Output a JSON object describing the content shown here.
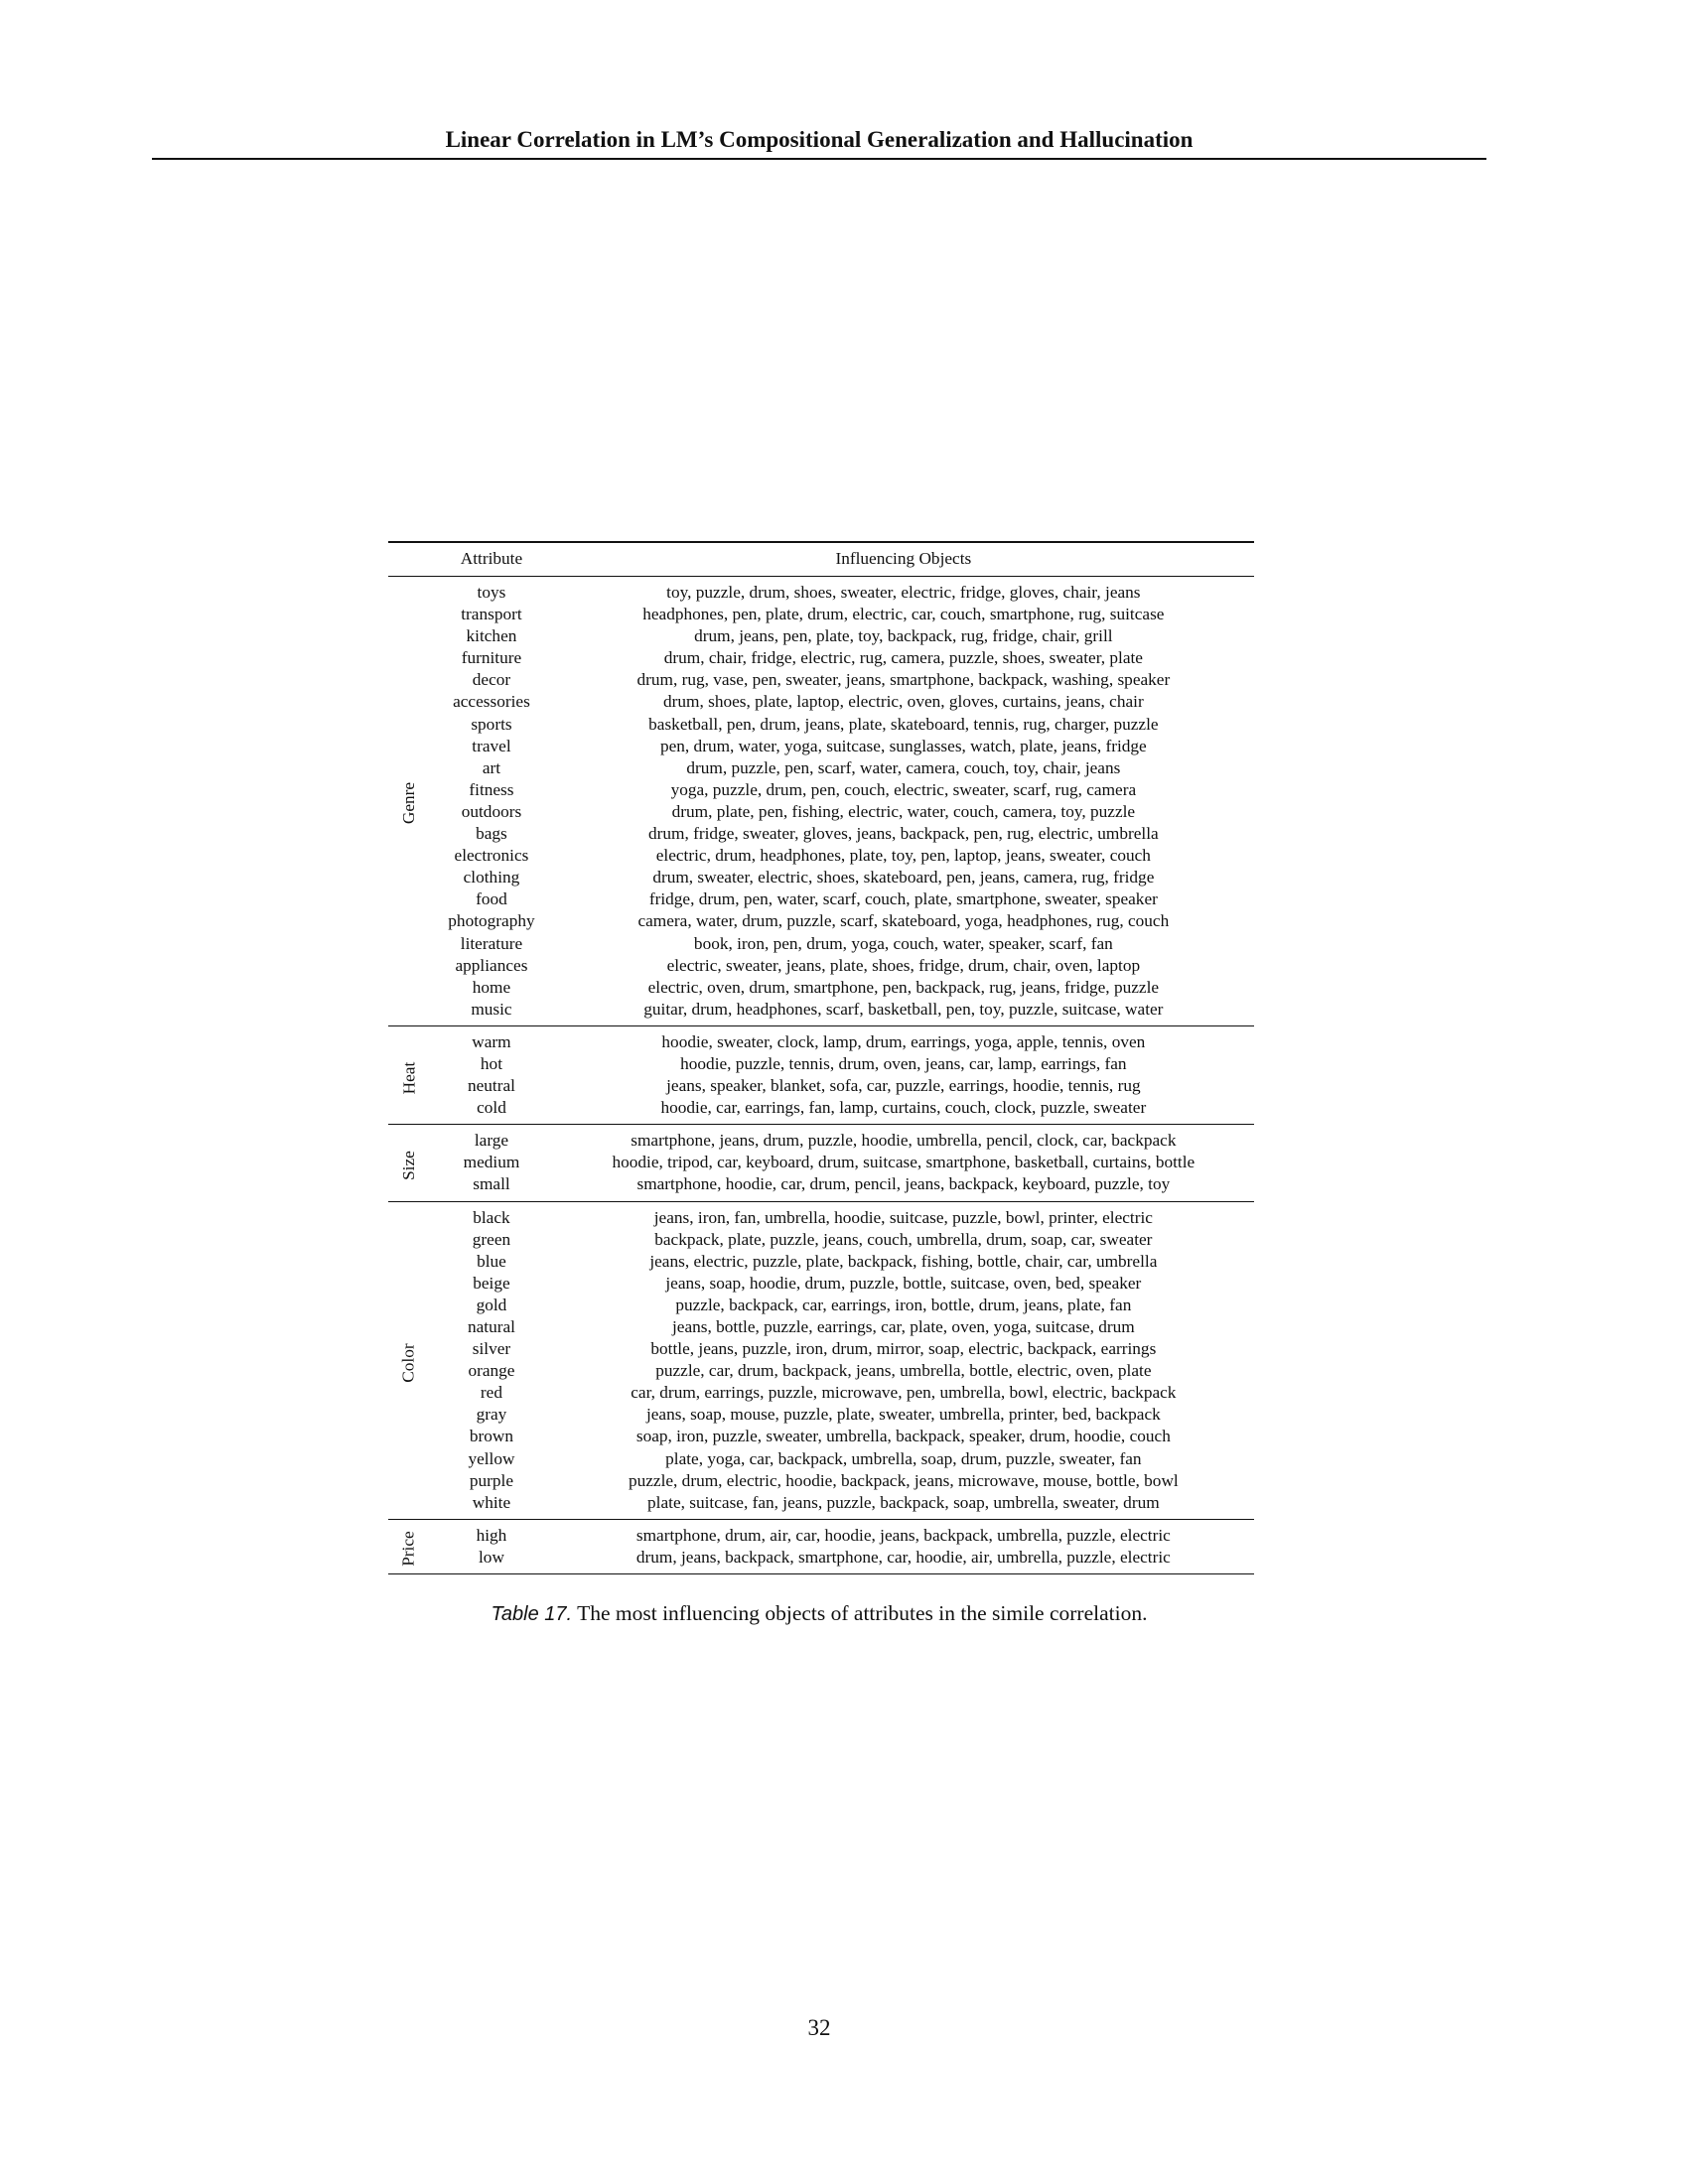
{
  "header": {
    "title": "Linear Correlation in LM’s Compositional Generalization and Hallucination"
  },
  "table": {
    "columns": [
      "",
      "Attribute",
      "Influencing Objects"
    ],
    "groups": [
      {
        "name": "Genre",
        "rows": [
          [
            "toys",
            "toy, puzzle, drum, shoes, sweater, electric, fridge, gloves, chair, jeans"
          ],
          [
            "transport",
            "headphones, pen, plate, drum, electric, car, couch, smartphone, rug, suitcase"
          ],
          [
            "kitchen",
            "drum, jeans, pen, plate, toy, backpack, rug, fridge, chair, grill"
          ],
          [
            "furniture",
            "drum, chair, fridge, electric, rug, camera, puzzle, shoes, sweater, plate"
          ],
          [
            "decor",
            "drum, rug, vase, pen, sweater, jeans, smartphone, backpack, washing, speaker"
          ],
          [
            "accessories",
            "drum, shoes, plate, laptop, electric, oven, gloves, curtains, jeans, chair"
          ],
          [
            "sports",
            "basketball, pen, drum, jeans, plate, skateboard, tennis, rug, charger, puzzle"
          ],
          [
            "travel",
            "pen, drum, water, yoga, suitcase, sunglasses, watch, plate, jeans, fridge"
          ],
          [
            "art",
            "drum, puzzle, pen, scarf, water, camera, couch, toy, chair, jeans"
          ],
          [
            "fitness",
            "yoga, puzzle, drum, pen, couch, electric, sweater, scarf, rug, camera"
          ],
          [
            "outdoors",
            "drum, plate, pen, fishing, electric, water, couch, camera, toy, puzzle"
          ],
          [
            "bags",
            "drum, fridge, sweater, gloves, jeans, backpack, pen, rug, electric, umbrella"
          ],
          [
            "electronics",
            "electric, drum, headphones, plate, toy, pen, laptop, jeans, sweater, couch"
          ],
          [
            "clothing",
            "drum, sweater, electric, shoes, skateboard, pen, jeans, camera, rug, fridge"
          ],
          [
            "food",
            "fridge, drum, pen, water, scarf, couch, plate, smartphone, sweater, speaker"
          ],
          [
            "photography",
            "camera, water, drum, puzzle, scarf, skateboard, yoga, headphones, rug, couch"
          ],
          [
            "literature",
            "book, iron, pen, drum, yoga, couch, water, speaker, scarf, fan"
          ],
          [
            "appliances",
            "electric, sweater, jeans, plate, shoes, fridge, drum, chair, oven, laptop"
          ],
          [
            "home",
            "electric, oven, drum, smartphone, pen, backpack, rug, jeans, fridge, puzzle"
          ],
          [
            "music",
            "guitar, drum, headphones, scarf, basketball, pen, toy, puzzle, suitcase, water"
          ]
        ]
      },
      {
        "name": "Heat",
        "rows": [
          [
            "warm",
            "hoodie, sweater, clock, lamp, drum, earrings, yoga, apple, tennis, oven"
          ],
          [
            "hot",
            "hoodie, puzzle, tennis, drum, oven, jeans, car, lamp, earrings, fan"
          ],
          [
            "neutral",
            "jeans, speaker, blanket, sofa, car, puzzle, earrings, hoodie, tennis, rug"
          ],
          [
            "cold",
            "hoodie, car, earrings, fan, lamp, curtains, couch, clock, puzzle, sweater"
          ]
        ]
      },
      {
        "name": "Size",
        "rows": [
          [
            "large",
            "smartphone, jeans, drum, puzzle, hoodie, umbrella, pencil, clock, car, backpack"
          ],
          [
            "medium",
            "hoodie, tripod, car, keyboard, drum, suitcase, smartphone, basketball, curtains, bottle"
          ],
          [
            "small",
            "smartphone, hoodie, car, drum, pencil, jeans, backpack, keyboard, puzzle, toy"
          ]
        ]
      },
      {
        "name": "Color",
        "rows": [
          [
            "black",
            "jeans, iron, fan, umbrella, hoodie, suitcase, puzzle, bowl, printer, electric"
          ],
          [
            "green",
            "backpack, plate, puzzle, jeans, couch, umbrella, drum, soap, car, sweater"
          ],
          [
            "blue",
            "jeans, electric, puzzle, plate, backpack, fishing, bottle, chair, car, umbrella"
          ],
          [
            "beige",
            "jeans, soap, hoodie, drum, puzzle, bottle, suitcase, oven, bed, speaker"
          ],
          [
            "gold",
            "puzzle, backpack, car, earrings, iron, bottle, drum, jeans, plate, fan"
          ],
          [
            "natural",
            "jeans, bottle, puzzle, earrings, car, plate, oven, yoga, suitcase, drum"
          ],
          [
            "silver",
            "bottle, jeans, puzzle, iron, drum, mirror, soap, electric, backpack, earrings"
          ],
          [
            "orange",
            "puzzle, car, drum, backpack, jeans, umbrella, bottle, electric, oven, plate"
          ],
          [
            "red",
            "car, drum, earrings, puzzle, microwave, pen, umbrella, bowl, electric, backpack"
          ],
          [
            "gray",
            "jeans, soap, mouse, puzzle, plate, sweater, umbrella, printer, bed, backpack"
          ],
          [
            "brown",
            "soap, iron, puzzle, sweater, umbrella, backpack, speaker, drum, hoodie, couch"
          ],
          [
            "yellow",
            "plate, yoga, car, backpack, umbrella, soap, drum, puzzle, sweater, fan"
          ],
          [
            "purple",
            "puzzle, drum, electric, hoodie, backpack, jeans, microwave, mouse, bottle, bowl"
          ],
          [
            "white",
            "plate, suitcase, fan, jeans, puzzle, backpack, soap, umbrella, sweater, drum"
          ]
        ]
      },
      {
        "name": "Price",
        "rows": [
          [
            "high",
            "smartphone, drum, air, car, hoodie, jeans, backpack, umbrella, puzzle, electric"
          ],
          [
            "low",
            "drum, jeans, backpack, smartphone, car, hoodie, air, umbrella, puzzle, electric"
          ]
        ]
      }
    ]
  },
  "caption": {
    "label": "Table 17.",
    "text": "The most influencing objects of attributes in the simile correlation."
  },
  "page_number": "32"
}
